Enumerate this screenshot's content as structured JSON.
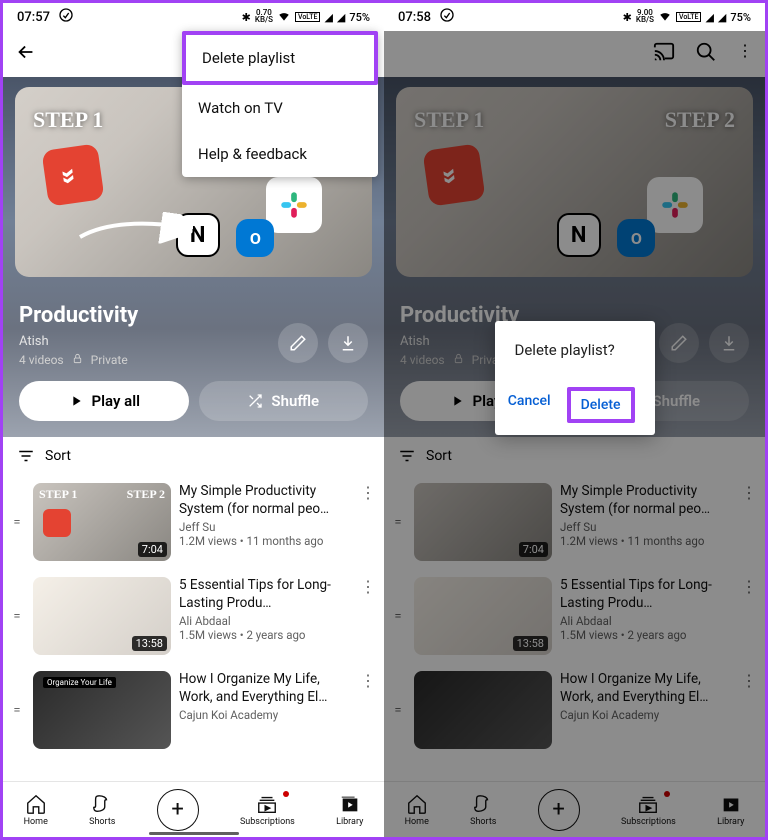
{
  "status": {
    "time_left": "07:57",
    "time_right": "07:58",
    "speed_left": "0.70",
    "speed_right": "9.00",
    "speed_unit": "KB/S",
    "battery": "75%"
  },
  "menu": {
    "delete": "Delete playlist",
    "watch_tv": "Watch on TV",
    "help": "Help & feedback"
  },
  "playlist": {
    "title": "Productivity",
    "owner": "Atish",
    "count": "4 videos",
    "privacy": "Private",
    "play_all": "Play all",
    "shuffle": "Shuffle"
  },
  "hero": {
    "step1": "STEP 1",
    "step2": "STEP 2"
  },
  "sort": {
    "label": "Sort"
  },
  "videos": [
    {
      "title": "My Simple Productivity System (for normal peo…",
      "channel": "Jeff Su",
      "meta": "1.2M views • 11 months ago",
      "duration": "7:04"
    },
    {
      "title": "5 Essential Tips for Long-Lasting Produ…",
      "channel": "Ali Abdaal",
      "meta": "1.5M views • 2 years ago",
      "duration": "13:58"
    },
    {
      "title": "How I Organize My Life, Work, and Everything El…",
      "channel": "Cajun Koi Academy",
      "meta": "",
      "duration": ""
    }
  ],
  "nav": {
    "home": "Home",
    "shorts": "Shorts",
    "subs": "Subscriptions",
    "library": "Library"
  },
  "dialog": {
    "title": "Delete playlist?",
    "cancel": "Cancel",
    "delete": "Delete"
  }
}
